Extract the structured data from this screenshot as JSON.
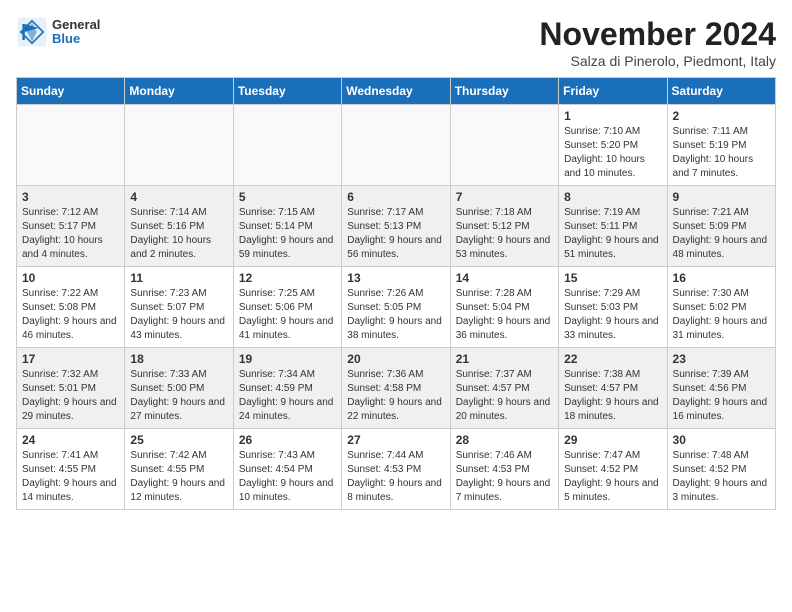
{
  "header": {
    "logo_general": "General",
    "logo_blue": "Blue",
    "title": "November 2024",
    "location": "Salza di Pinerolo, Piedmont, Italy"
  },
  "weekdays": [
    "Sunday",
    "Monday",
    "Tuesday",
    "Wednesday",
    "Thursday",
    "Friday",
    "Saturday"
  ],
  "weeks": [
    [
      {
        "day": "",
        "info": "",
        "empty": true
      },
      {
        "day": "",
        "info": "",
        "empty": true
      },
      {
        "day": "",
        "info": "",
        "empty": true
      },
      {
        "day": "",
        "info": "",
        "empty": true
      },
      {
        "day": "",
        "info": "",
        "empty": true
      },
      {
        "day": "1",
        "info": "Sunrise: 7:10 AM\nSunset: 5:20 PM\nDaylight: 10 hours and 10 minutes."
      },
      {
        "day": "2",
        "info": "Sunrise: 7:11 AM\nSunset: 5:19 PM\nDaylight: 10 hours and 7 minutes."
      }
    ],
    [
      {
        "day": "3",
        "info": "Sunrise: 7:12 AM\nSunset: 5:17 PM\nDaylight: 10 hours and 4 minutes."
      },
      {
        "day": "4",
        "info": "Sunrise: 7:14 AM\nSunset: 5:16 PM\nDaylight: 10 hours and 2 minutes."
      },
      {
        "day": "5",
        "info": "Sunrise: 7:15 AM\nSunset: 5:14 PM\nDaylight: 9 hours and 59 minutes."
      },
      {
        "day": "6",
        "info": "Sunrise: 7:17 AM\nSunset: 5:13 PM\nDaylight: 9 hours and 56 minutes."
      },
      {
        "day": "7",
        "info": "Sunrise: 7:18 AM\nSunset: 5:12 PM\nDaylight: 9 hours and 53 minutes."
      },
      {
        "day": "8",
        "info": "Sunrise: 7:19 AM\nSunset: 5:11 PM\nDaylight: 9 hours and 51 minutes."
      },
      {
        "day": "9",
        "info": "Sunrise: 7:21 AM\nSunset: 5:09 PM\nDaylight: 9 hours and 48 minutes."
      }
    ],
    [
      {
        "day": "10",
        "info": "Sunrise: 7:22 AM\nSunset: 5:08 PM\nDaylight: 9 hours and 46 minutes."
      },
      {
        "day": "11",
        "info": "Sunrise: 7:23 AM\nSunset: 5:07 PM\nDaylight: 9 hours and 43 minutes."
      },
      {
        "day": "12",
        "info": "Sunrise: 7:25 AM\nSunset: 5:06 PM\nDaylight: 9 hours and 41 minutes."
      },
      {
        "day": "13",
        "info": "Sunrise: 7:26 AM\nSunset: 5:05 PM\nDaylight: 9 hours and 38 minutes."
      },
      {
        "day": "14",
        "info": "Sunrise: 7:28 AM\nSunset: 5:04 PM\nDaylight: 9 hours and 36 minutes."
      },
      {
        "day": "15",
        "info": "Sunrise: 7:29 AM\nSunset: 5:03 PM\nDaylight: 9 hours and 33 minutes."
      },
      {
        "day": "16",
        "info": "Sunrise: 7:30 AM\nSunset: 5:02 PM\nDaylight: 9 hours and 31 minutes."
      }
    ],
    [
      {
        "day": "17",
        "info": "Sunrise: 7:32 AM\nSunset: 5:01 PM\nDaylight: 9 hours and 29 minutes."
      },
      {
        "day": "18",
        "info": "Sunrise: 7:33 AM\nSunset: 5:00 PM\nDaylight: 9 hours and 27 minutes."
      },
      {
        "day": "19",
        "info": "Sunrise: 7:34 AM\nSunset: 4:59 PM\nDaylight: 9 hours and 24 minutes."
      },
      {
        "day": "20",
        "info": "Sunrise: 7:36 AM\nSunset: 4:58 PM\nDaylight: 9 hours and 22 minutes."
      },
      {
        "day": "21",
        "info": "Sunrise: 7:37 AM\nSunset: 4:57 PM\nDaylight: 9 hours and 20 minutes."
      },
      {
        "day": "22",
        "info": "Sunrise: 7:38 AM\nSunset: 4:57 PM\nDaylight: 9 hours and 18 minutes."
      },
      {
        "day": "23",
        "info": "Sunrise: 7:39 AM\nSunset: 4:56 PM\nDaylight: 9 hours and 16 minutes."
      }
    ],
    [
      {
        "day": "24",
        "info": "Sunrise: 7:41 AM\nSunset: 4:55 PM\nDaylight: 9 hours and 14 minutes."
      },
      {
        "day": "25",
        "info": "Sunrise: 7:42 AM\nSunset: 4:55 PM\nDaylight: 9 hours and 12 minutes."
      },
      {
        "day": "26",
        "info": "Sunrise: 7:43 AM\nSunset: 4:54 PM\nDaylight: 9 hours and 10 minutes."
      },
      {
        "day": "27",
        "info": "Sunrise: 7:44 AM\nSunset: 4:53 PM\nDaylight: 9 hours and 8 minutes."
      },
      {
        "day": "28",
        "info": "Sunrise: 7:46 AM\nSunset: 4:53 PM\nDaylight: 9 hours and 7 minutes."
      },
      {
        "day": "29",
        "info": "Sunrise: 7:47 AM\nSunset: 4:52 PM\nDaylight: 9 hours and 5 minutes."
      },
      {
        "day": "30",
        "info": "Sunrise: 7:48 AM\nSunset: 4:52 PM\nDaylight: 9 hours and 3 minutes."
      }
    ]
  ]
}
